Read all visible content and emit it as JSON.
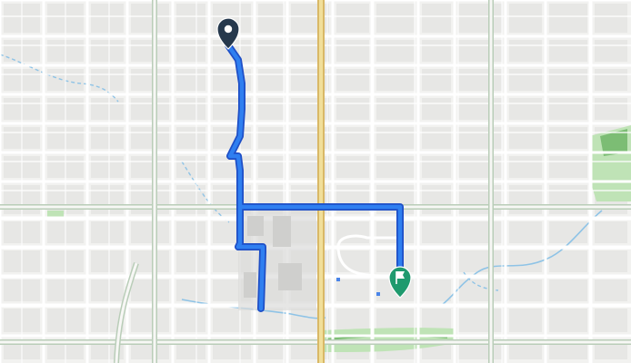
{
  "map": {
    "colors": {
      "background": "#f2f2f0",
      "block": "#e7e7e5",
      "building": "#dcdcda",
      "minor_road": "#ffffff",
      "major_road_casing": "#b9cdb8",
      "major_road": "#f7f7f5",
      "highway_casing": "#d9b866",
      "highway": "#f1df9a",
      "park": "#bfe3b6",
      "park_dark": "#7cbd74",
      "water": "#c4dcef",
      "stream": "#8ec3e6",
      "route_casing": "#1f4fc6",
      "route": "#2f7ff0",
      "start_marker": "#26394d",
      "end_marker": "#1f9a6e",
      "parking": "#4a84e8"
    },
    "markers": {
      "start": {
        "icon": "start-pin-icon"
      },
      "end": {
        "icon": "finish-flag-pin-icon"
      }
    }
  }
}
